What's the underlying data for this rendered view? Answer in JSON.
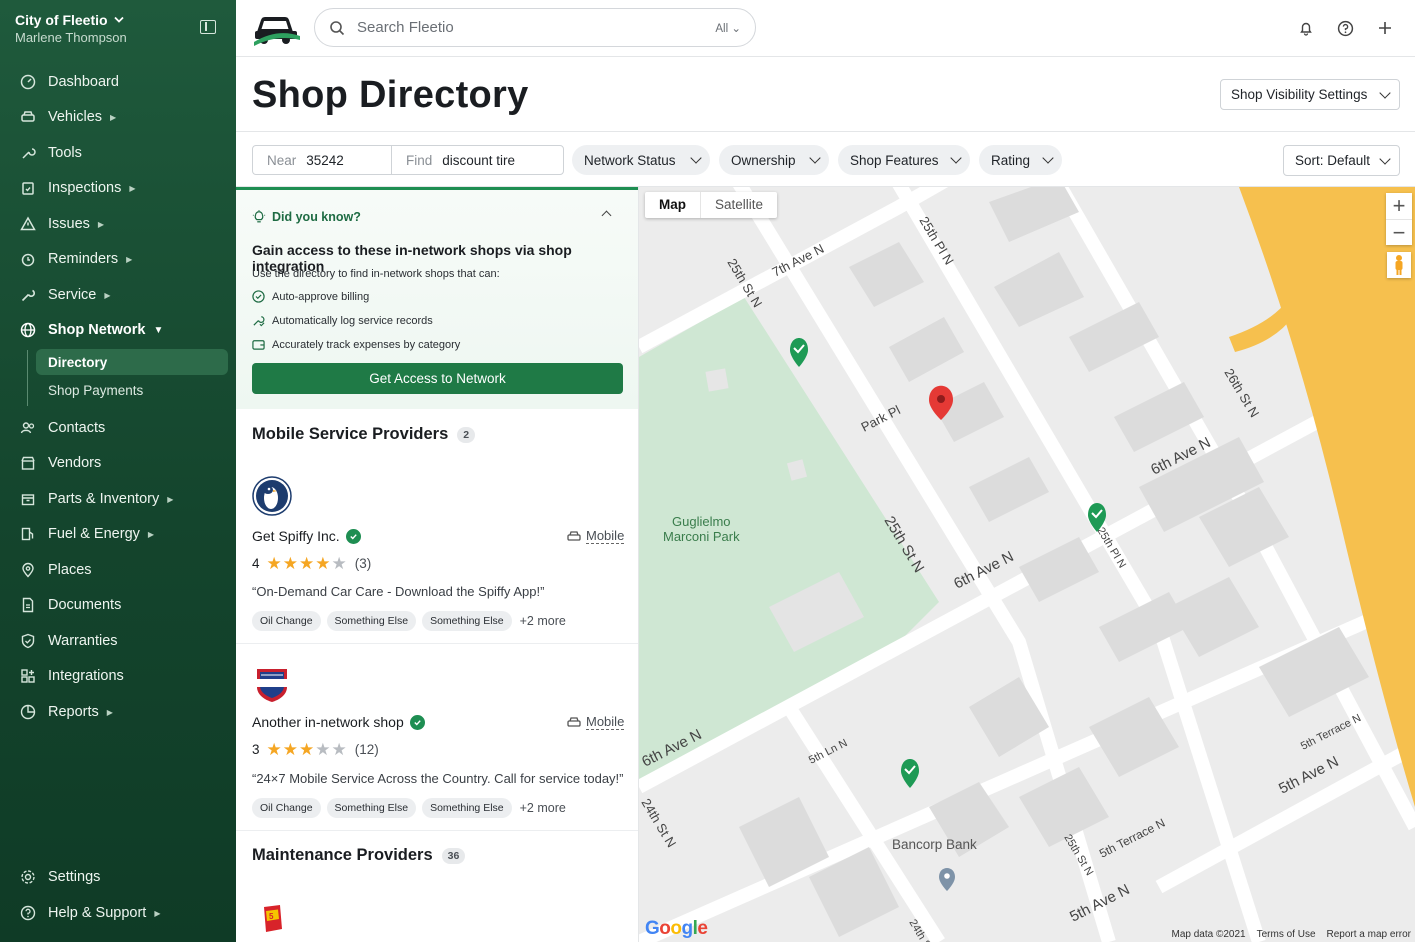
{
  "sidebar": {
    "org_name": "City of Fleetio",
    "user_name": "Marlene Thompson",
    "items": [
      {
        "label": "Dashboard"
      },
      {
        "label": "Vehicles"
      },
      {
        "label": "Tools"
      },
      {
        "label": "Inspections"
      },
      {
        "label": "Issues"
      },
      {
        "label": "Reminders"
      },
      {
        "label": "Service"
      },
      {
        "label": "Shop Network"
      },
      {
        "label": "Contacts"
      },
      {
        "label": "Vendors"
      },
      {
        "label": "Parts & Inventory"
      },
      {
        "label": "Fuel & Energy"
      },
      {
        "label": "Places"
      },
      {
        "label": "Documents"
      },
      {
        "label": "Warranties"
      },
      {
        "label": "Integrations"
      },
      {
        "label": "Reports"
      }
    ],
    "sub_items": [
      {
        "label": "Directory"
      },
      {
        "label": "Shop Payments"
      }
    ],
    "footer": [
      {
        "label": "Settings"
      },
      {
        "label": "Help & Support"
      }
    ]
  },
  "topbar": {
    "search_placeholder": "Search Fleetio",
    "search_scope": "All"
  },
  "header": {
    "title": "Shop Directory",
    "visibility_button": "Shop Visibility Settings"
  },
  "filters": {
    "near_label": "Near",
    "near_value": "35242",
    "find_label": "Find",
    "find_value": "discount tire",
    "chips": [
      "Network Status",
      "Ownership",
      "Shop Features",
      "Rating"
    ],
    "sort": "Sort: Default"
  },
  "did_you_know": {
    "heading": "Did you know?",
    "title": "Gain access to these in-network shops via shop integration",
    "desc": "Use the directory to find in-network shops that can:",
    "items": [
      "Auto-approve billing",
      "Automatically log service records",
      "Accurately track expenses by category"
    ],
    "cta": "Get Access to Network"
  },
  "mobile_section": {
    "title": "Mobile Service Providers",
    "count": "2"
  },
  "maintenance_section": {
    "title": "Maintenance Providers",
    "count": "36"
  },
  "shops": [
    {
      "name": "Get Spiffy Inc.",
      "type": "Mobile",
      "rating": "4",
      "stars": 4,
      "reviews": "(3)",
      "quote": "“On-Demand Car Care - Download the Spiffy App!”",
      "tags": [
        "Oil Change",
        "Something Else",
        "Something Else"
      ],
      "more": "+2 more"
    },
    {
      "name": "Another in-network shop",
      "type": "Mobile",
      "rating": "3",
      "stars": 3,
      "reviews": "(12)",
      "quote": "“24×7 Mobile Service Across the Country. Call for service today!”",
      "tags": [
        "Oil Change",
        "Something Else",
        "Something Else"
      ],
      "more": "+2 more"
    }
  ],
  "map": {
    "tab_map": "Map",
    "tab_satellite": "Satellite",
    "park_name": "Guglielmo Marconi Park",
    "bank_name": "Bancorp Bank",
    "streets": [
      "7th Ave N",
      "25th St N",
      "25th Pl N",
      "Park Pl",
      "26th St N",
      "6th Ave N",
      "6th Ave N",
      "25th Pl N",
      "25th St N",
      "6th Ave N",
      "5th Ln N",
      "5th Terrace N",
      "5th Ave N",
      "5th Terrace N",
      "25th St N",
      "5th Ave N",
      "24th St N",
      "24th St N"
    ],
    "google": "Google",
    "footer": [
      "Map data ©2021",
      "Terms of Use",
      "Report a map error"
    ]
  }
}
